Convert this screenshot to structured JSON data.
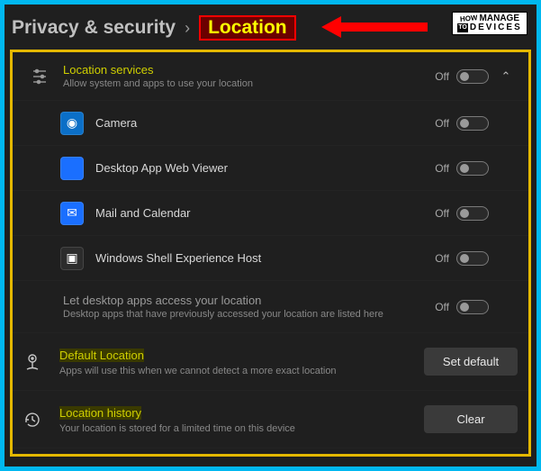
{
  "breadcrumb": {
    "parent": "Privacy & security",
    "current": "Location"
  },
  "logo": {
    "l1a": "HOW",
    "l1b": "MANAGE",
    "to": "TO",
    "l2": "DEVICES"
  },
  "locationServices": {
    "title": "Location services",
    "subtitle": "Allow system and apps to use your location",
    "state": "Off"
  },
  "apps": [
    {
      "name": "Camera",
      "iconColor": "#0b6fc7",
      "glyph": "◉",
      "state": "Off"
    },
    {
      "name": "Desktop App Web Viewer",
      "iconColor": "#1a6fff",
      "glyph": "",
      "state": "Off"
    },
    {
      "name": "Mail and Calendar",
      "iconColor": "#1a6fff",
      "glyph": "✉",
      "state": "Off"
    },
    {
      "name": "Windows Shell Experience Host",
      "iconColor": "#2c2c2c",
      "glyph": "▣",
      "state": "Off"
    }
  ],
  "desktopApps": {
    "title": "Let desktop apps access your location",
    "subtitle": "Desktop apps that have previously accessed your location are listed here",
    "state": "Off"
  },
  "defaultLocation": {
    "title": "Default Location",
    "subtitle": "Apps will use this when we cannot detect a more exact location",
    "button": "Set default"
  },
  "locationHistory": {
    "title": "Location history",
    "subtitle": "Your location is stored for a limited time on this device",
    "button": "Clear"
  }
}
